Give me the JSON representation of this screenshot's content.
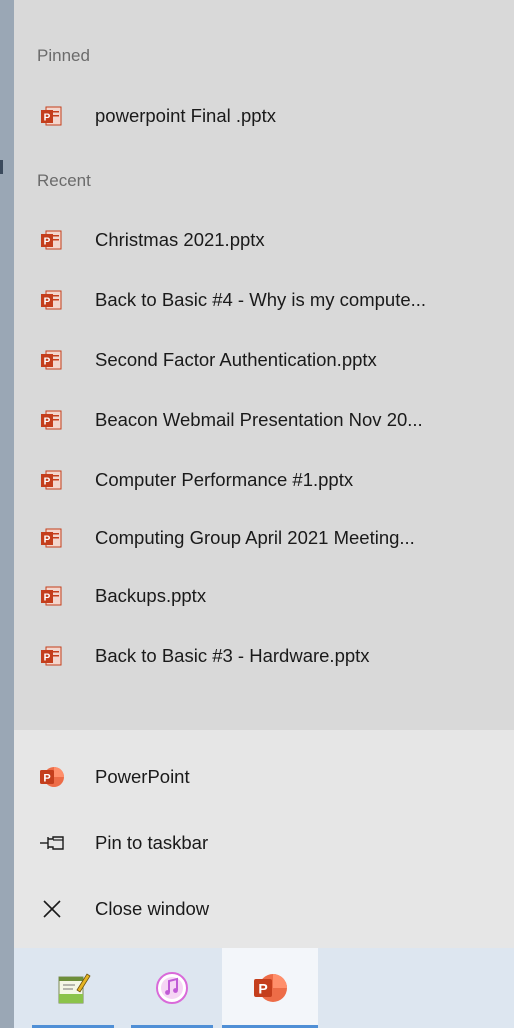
{
  "jumplist": {
    "pinned_header": "Pinned",
    "pinned_items": [
      {
        "label": "powerpoint Final .pptx",
        "icon": "powerpoint-file-icon"
      }
    ],
    "recent_header": "Recent",
    "recent_items": [
      {
        "label": "Christmas 2021.pptx",
        "icon": "powerpoint-file-icon"
      },
      {
        "label": "Back to Basic #4 - Why is my compute...",
        "icon": "powerpoint-file-icon"
      },
      {
        "label": "Second Factor Authentication.pptx",
        "icon": "powerpoint-file-icon"
      },
      {
        "label": "Beacon Webmail Presentation Nov 20...",
        "icon": "powerpoint-file-icon"
      },
      {
        "label": "Computer Performance #1.pptx",
        "icon": "powerpoint-file-icon"
      },
      {
        "label": "Computing Group April 2021 Meeting...",
        "icon": "powerpoint-file-icon"
      },
      {
        "label": "Backups.pptx",
        "icon": "powerpoint-file-icon"
      },
      {
        "label": "Back to Basic #3 - Hardware.pptx",
        "icon": "powerpoint-file-icon"
      }
    ]
  },
  "tasks": {
    "app_label": "PowerPoint",
    "pin_label": "Pin to taskbar",
    "close_label": "Close window"
  },
  "taskbar": {
    "apps": [
      {
        "name": "notepad",
        "icon": "notepad-icon",
        "active": false
      },
      {
        "name": "itunes",
        "icon": "itunes-icon",
        "active": false
      },
      {
        "name": "powerpoint",
        "icon": "powerpoint-app-icon",
        "active": true
      }
    ]
  },
  "colors": {
    "powerpoint_red": "#c43e1c",
    "panel_bg": "#d9d9d9",
    "tasks_bg": "#e6e6e6",
    "taskbar_bg": "#dde6f0",
    "taskbar_indicator": "#4f8fd6"
  }
}
